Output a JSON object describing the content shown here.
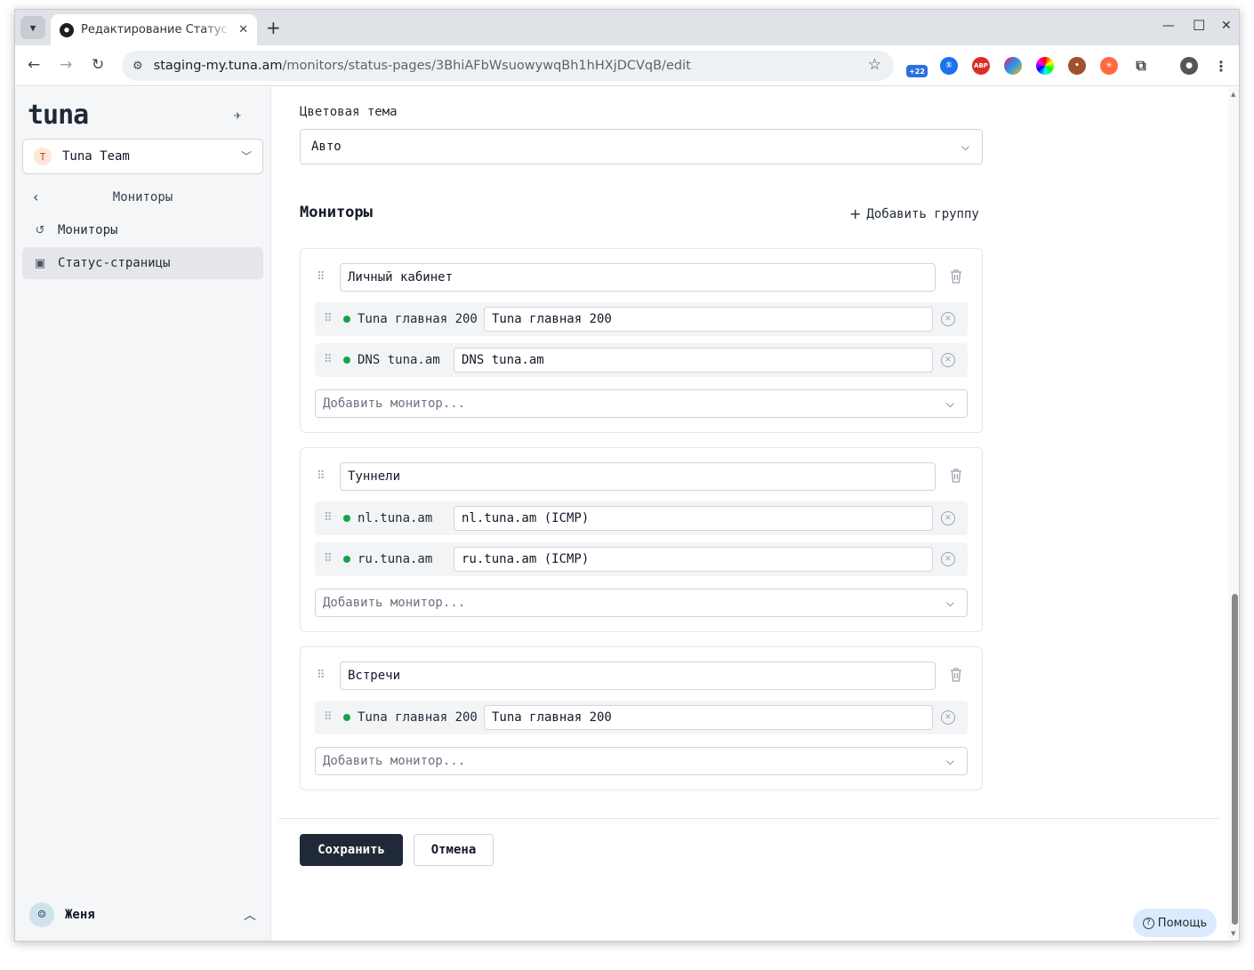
{
  "browser": {
    "tab_title": "Редактирование Статус pa",
    "tab_close": "✕",
    "new_tab": "+",
    "url_host": "staging-my.tuna.am",
    "url_path": "/monitors/status-pages/3BhiAFbWsuowywqBh1hHXjDCVqB/edit",
    "ext_badge": "+22",
    "ext_abp": "ABP"
  },
  "sidebar": {
    "logo": "tuna",
    "team_initial": "T",
    "team_name": "Tuna Team",
    "back_label": "Мониторы",
    "items": [
      {
        "label": "Мониторы",
        "icon": "history-icon",
        "active": false
      },
      {
        "label": "Статус-страницы",
        "icon": "chart-icon",
        "active": true
      }
    ],
    "user_name": "Женя"
  },
  "main": {
    "theme_label": "Цветовая тема",
    "theme_value": "Авто",
    "monitors_title": "Мониторы",
    "add_group_label": "Добавить группу",
    "add_monitor_placeholder": "Добавить монитор...",
    "groups": [
      {
        "name": "Личный кабинет",
        "monitors": [
          {
            "name": "Tuna главная 200",
            "display": "Tuna главная 200",
            "status_color": "#16a34a"
          },
          {
            "name": "DNS tuna.am",
            "display": "DNS tuna.am",
            "status_color": "#16a34a"
          }
        ]
      },
      {
        "name": "Туннели",
        "monitors": [
          {
            "name": "nl.tuna.am",
            "display": "nl.tuna.am (ICMP)",
            "status_color": "#16a34a"
          },
          {
            "name": "ru.tuna.am",
            "display": "ru.tuna.am (ICMP)",
            "status_color": "#16a34a"
          }
        ]
      },
      {
        "name": "Встречи",
        "monitors": [
          {
            "name": "Tuna главная 200",
            "display": "Tuna главная 200",
            "status_color": "#16a34a"
          }
        ]
      }
    ],
    "save_label": "Сохранить",
    "cancel_label": "Отмена",
    "help_label": "Помощь"
  }
}
